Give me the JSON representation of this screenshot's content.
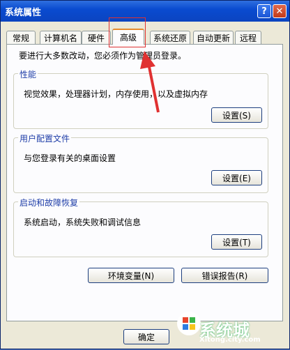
{
  "window": {
    "title": "系统属性",
    "help_glyph": "?",
    "close_glyph": "✕"
  },
  "tabs": [
    {
      "label": "常规"
    },
    {
      "label": "计算机名"
    },
    {
      "label": "硬件"
    },
    {
      "label": "高级",
      "active": true
    },
    {
      "label": "系统还原"
    },
    {
      "label": "自动更新"
    },
    {
      "label": "远程"
    }
  ],
  "notice": "要进行大多数改动，您必须作为管理员登录。",
  "groups": {
    "performance": {
      "title": "性能",
      "desc": "视觉效果，处理器计划，内存使用，以及虚拟内存",
      "button": "设置(S)"
    },
    "profile": {
      "title": "用户配置文件",
      "desc": "与您登录有关的桌面设置",
      "button": "设置(E)"
    },
    "startup": {
      "title": "启动和故障恢复",
      "desc": "系统启动，系统失败和调试信息",
      "button": "设置(T)"
    }
  },
  "buttons": {
    "env": "环境变量(N)",
    "error": "错误报告(R)",
    "ok": "确定"
  },
  "watermark": {
    "brand": "系统城",
    "url": "Xitong.city.com"
  },
  "colors": {
    "title_bar": "#0a4bd0",
    "group_title": "#1f3ea8",
    "highlight": "#e03131"
  }
}
